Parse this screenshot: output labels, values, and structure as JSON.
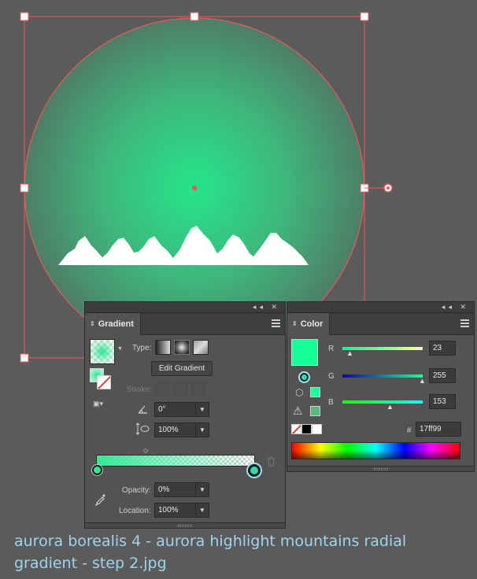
{
  "gradient_panel": {
    "title": "Gradient",
    "type_label": "Type:",
    "edit_gradient_label": "Edit Gradient",
    "stroke_label": "Stroke:",
    "angle_value": "0°",
    "aspect_value": "100%",
    "opacity_label": "Opacity:",
    "opacity_value": "0%",
    "location_label": "Location:",
    "location_value": "100%",
    "active_type": "radial",
    "stop_start_color": "#34e893",
    "stop_end_color": "#17ff99"
  },
  "color_panel": {
    "title": "Color",
    "r_label": "R",
    "r_value": "23",
    "g_label": "G",
    "g_value": "255",
    "b_label": "B",
    "b_value": "153",
    "hex_label": "#",
    "hex_value": "17ff99",
    "fill_color": "#17ff99",
    "r_fraction": 0.09,
    "g_fraction": 1.0,
    "b_fraction": 0.6
  },
  "caption": {
    "text": "aurora borealis 4 - aurora highlight mountains radial gradient - step 2.jpg"
  },
  "colors": {
    "selection": "#e85a5a",
    "gradient_center": "#25e58a",
    "gradient_edge": "#4d8a6c",
    "caption": "#9fd4ee"
  }
}
